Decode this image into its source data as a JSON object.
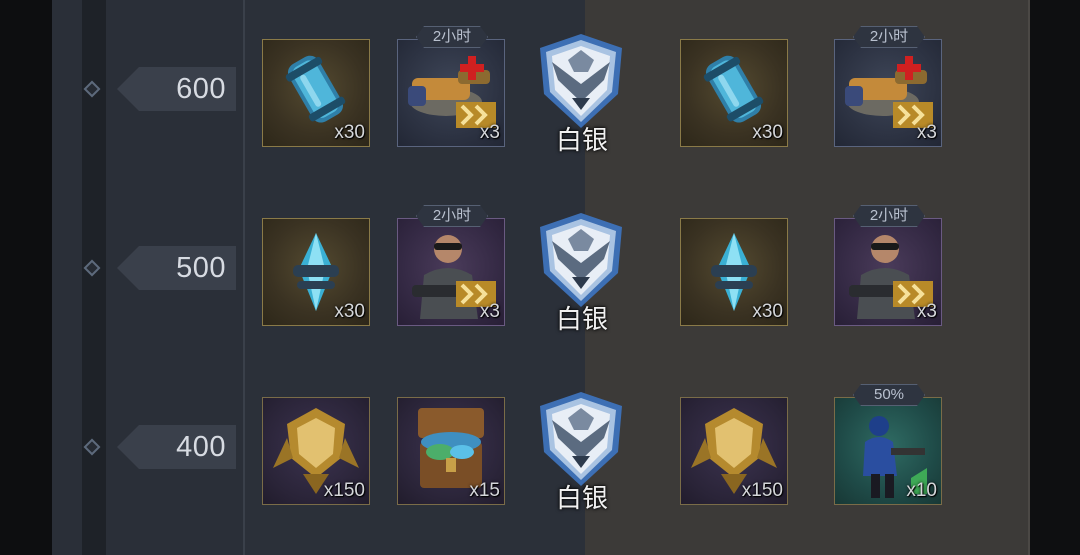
{
  "tiers": [
    {
      "level": "600",
      "rank_label": "白银",
      "free_rewards": [
        {
          "icon": "blue-capsule-icon",
          "qty": "x30",
          "tag": ""
        },
        {
          "icon": "tank-drone-repair-icon",
          "qty": "x3",
          "tag": "2小时"
        }
      ],
      "paid_rewards": [
        {
          "icon": "blue-capsule-icon",
          "qty": "x30",
          "tag": ""
        },
        {
          "icon": "tank-drone-repair-icon",
          "qty": "x3",
          "tag": "2小时"
        }
      ]
    },
    {
      "level": "500",
      "rank_label": "白银",
      "free_rewards": [
        {
          "icon": "blue-crystal-icon",
          "qty": "x30",
          "tag": ""
        },
        {
          "icon": "soldier-portrait-icon",
          "qty": "x3",
          "tag": "2小时"
        }
      ],
      "paid_rewards": [
        {
          "icon": "blue-crystal-icon",
          "qty": "x30",
          "tag": ""
        },
        {
          "icon": "soldier-portrait-icon",
          "qty": "x3",
          "tag": "2小时"
        }
      ]
    },
    {
      "level": "400",
      "rank_label": "白银",
      "free_rewards": [
        {
          "icon": "gold-emblem-icon",
          "qty": "x150",
          "tag": ""
        },
        {
          "icon": "treasure-chest-icon",
          "qty": "x15",
          "tag": ""
        }
      ],
      "paid_rewards": [
        {
          "icon": "gold-emblem-icon",
          "qty": "x150",
          "tag": ""
        },
        {
          "icon": "soldier-card-icon",
          "qty": "x10",
          "tag": "50%"
        }
      ]
    }
  ],
  "colors": {
    "free_panel": "#2b3039",
    "paid_panel": "#3c3a38",
    "track_panel": "#2a2f38",
    "level_tag": "#3a404b"
  }
}
